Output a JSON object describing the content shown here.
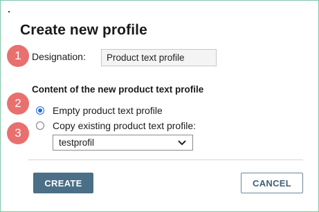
{
  "dialog": {
    "title": "Create new profile"
  },
  "markers": [
    "1",
    "2",
    "3"
  ],
  "designation": {
    "label": "Designation:",
    "value": "Product text profile"
  },
  "content": {
    "heading": "Content of the new product text profile",
    "options": [
      {
        "label": "Empty product text profile",
        "selected": true
      },
      {
        "label": "Copy existing product text profile:",
        "selected": false
      }
    ],
    "existing_profile_select": {
      "selected": "testprofil"
    }
  },
  "buttons": {
    "create_label": "CREATE",
    "cancel_label": "CANCEL"
  },
  "colors": {
    "primary_button": "#4a6f86",
    "marker": "#e8706f",
    "radio_selected": "#1f6fd6",
    "frame_border": "#7fc6a8"
  },
  "icons": {
    "dropdown": "chevron-down-icon"
  }
}
